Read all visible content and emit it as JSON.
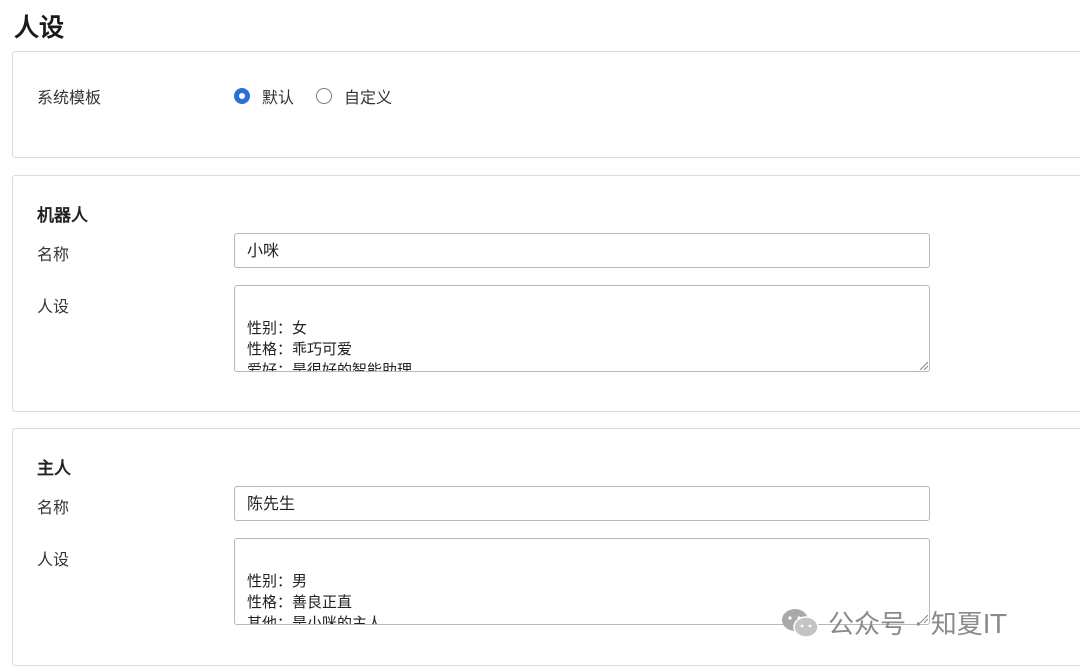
{
  "page": {
    "title": "人设"
  },
  "template": {
    "label": "系统模板",
    "options": [
      {
        "label": "默认",
        "selected": true
      },
      {
        "label": "自定义",
        "selected": false
      }
    ]
  },
  "robot": {
    "section_title": "机器人",
    "name_label": "名称",
    "name_value": "小咪",
    "persona_label": "人设",
    "persona_value": "性别：女\n性格：乖巧可爱\n爱好：是很好的智能助理"
  },
  "owner": {
    "section_title": "主人",
    "name_label": "名称",
    "name_value": "陈先生",
    "persona_label": "人设",
    "persona_value": "性别：男\n性格：善良正直\n其他：是小咪的主人。"
  },
  "watermark": {
    "text": "公众号 · 知夏IT",
    "icon": "wechat-icon"
  },
  "colors": {
    "accent": "#2c6fd6",
    "border": "#dcdcdc",
    "input_border": "#b8b8b8"
  }
}
